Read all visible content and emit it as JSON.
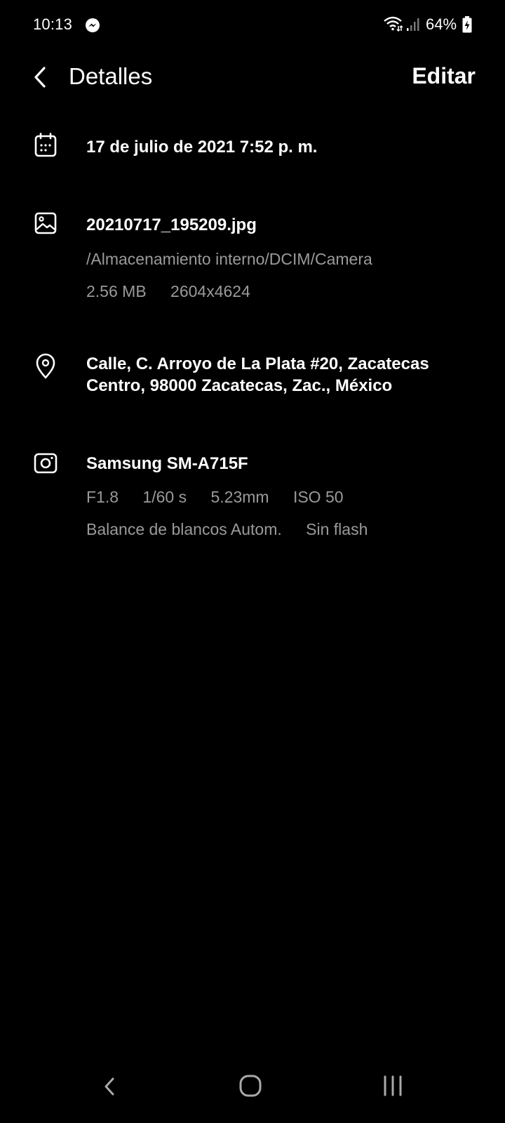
{
  "status_bar": {
    "time": "10:13",
    "battery": "64%",
    "icons": [
      "messenger-icon",
      "wifi-icon",
      "signal-icon",
      "battery-charging-icon"
    ]
  },
  "header": {
    "title": "Detalles",
    "edit_label": "Editar",
    "back_icon": "chevron-left-icon"
  },
  "details": {
    "date": {
      "icon": "calendar-icon",
      "text": "17 de julio de 2021 7:52 p. m."
    },
    "file": {
      "icon": "image-icon",
      "name": "20210717_195209.jpg",
      "path": "/Almacenamiento interno/DCIM/Camera",
      "size": "2.56 MB",
      "resolution": "2604x4624"
    },
    "location": {
      "icon": "location-pin-icon",
      "line1": "Calle, C. Arroyo de La Plata #20, Zacatecas",
      "line2": "Centro, 98000 Zacatecas, Zac., México"
    },
    "camera": {
      "icon": "camera-icon",
      "model": "Samsung SM-A715F",
      "aperture": "F1.8",
      "shutter": "1/60 s",
      "focal_length": "5.23mm",
      "iso": "ISO 50",
      "white_balance": "Balance de blancos Autom.",
      "flash": "Sin flash"
    }
  },
  "nav_bar": {
    "icons": [
      "nav-back-icon",
      "nav-home-icon",
      "nav-recents-icon"
    ]
  },
  "colors": {
    "background": "#000000",
    "primary_text": "#ffffff",
    "secondary_text": "#9a9a9a"
  }
}
